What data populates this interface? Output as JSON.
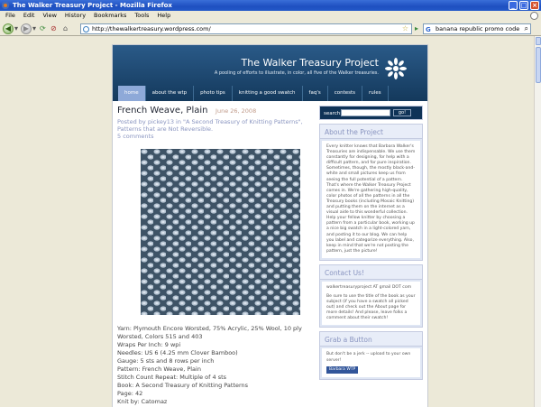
{
  "window": {
    "title": "The Walker Treasury Project - Mozilla Firefox"
  },
  "menu": [
    "File",
    "Edit",
    "View",
    "History",
    "Bookmarks",
    "Tools",
    "Help"
  ],
  "nav": {
    "url": "http://thewalkertreasury.wordpress.com/",
    "search": "banana republic promo code"
  },
  "blog": {
    "title": "The Walker Treasury Project",
    "tagline": "A pooling of efforts to illustrate, in color, all five of the Walker treasuries.",
    "tabs": [
      "home",
      "about the wtp",
      "photo tips",
      "knitting a good swatch",
      "faq's",
      "contests",
      "rules"
    ]
  },
  "post": {
    "title": "French Weave, Plain",
    "date": "June 26, 2008",
    "meta": "Posted by pickey13 in \"A Second Treasury of Knitting Patterns\", Patterns that are Not Reversible.",
    "comments": "5 comments",
    "details": [
      "Yarn: Plymouth Encore Worsted, 75% Acrylic, 25% Wool, 10 ply Worsted, Colors 515 and 403",
      "Wraps Per Inch: 9 wpi",
      "Needles: US 6 (4.25 mm Clover Bamboo)",
      "Gauge: 5 sts and 8 rows per inch",
      "Pattern: French Weave, Plain",
      "Stitch Count Repeat: Multiple of 4 sts",
      "Book: A Second Treasury of Knitting Patterns",
      "Page: 42"
    ],
    "footer": "Knit by: Catomaz"
  },
  "sidebar": {
    "search_label": "search:",
    "search_button": "go!",
    "about_title": "About the Project",
    "about_text": "Every knitter knows that Barbara Walker's Treasuries are indispensable. We use them constantly for designing, for help with a difficult pattern, and for pure inspiration. Sometimes, though, the mostly black-and-white and small pictures keep us from seeing the full potential of a pattern. That's where the Walker Treasury Project comes in. We're gathering high-quality, color photos of all the patterns in all the Treasury books (including Mosaic Knitting) and putting them on the internet as a visual aide to this wonderful collection. Help your fellow knitter by choosing a pattern from a particular book, working up a nice big swatch in a light-colored yarn, and posting it to our blog. We can help you label and categorize everything. Also, keep in mind that we're not posting the pattern, just the picture!",
    "contact_title": "Contact Us!",
    "contact_email": "walkertreasuryproject AT gmail DOT com",
    "contact_text": "Be sure to use the title of the book as your subject (if you have a swatch all picked out) and check out the About page for more details! And please, leave folks a comment about their swatch!",
    "button_title": "Grab a Button",
    "button_text": "But don't be a jerk -- upload to your own server!",
    "button_badge": "Barbara WTP"
  }
}
